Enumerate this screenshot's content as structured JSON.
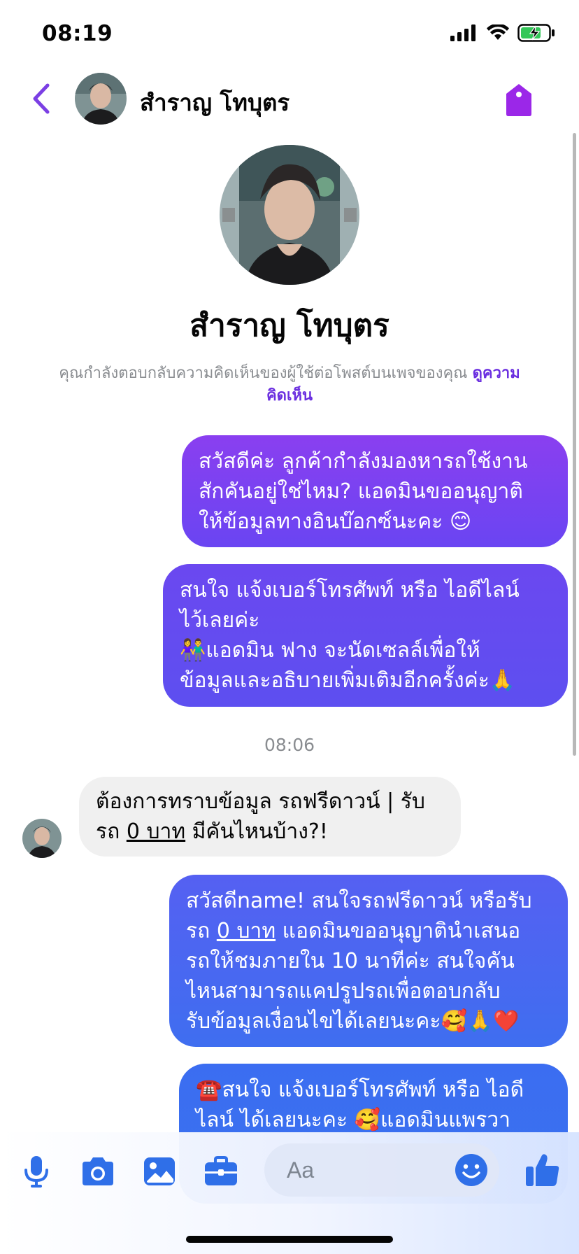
{
  "status_bar": {
    "time": "08:19"
  },
  "header": {
    "contact_name": "สำราญ โทบุตร"
  },
  "profile": {
    "name": "สำราญ โทบุตร"
  },
  "context": {
    "note": "คุณกำลังตอบกลับความคิดเห็นของผู้ใช้ต่อโพสต์บนเพจของคุณ",
    "link_line1": "ดูความ",
    "link_line2": "คิดเห็น"
  },
  "messages": [
    {
      "direction": "outgoing",
      "lines": [
        "สวัสดีค่ะ ลูกค้ากำลังมองหารถใช้งาน",
        "สักคันอยู่ใช่ไหม? แอดมินขออนุญาติ",
        "ให้ข้อมูลทางอินบ๊อกซ์นะคะ 😊"
      ]
    },
    {
      "direction": "outgoing",
      "lines": [
        "สนใจ แจ้งเบอร์โทรศัพท์ หรือ ไอดีไลน์",
        "ไว้เลยค่ะ",
        "👫แอดมิน ฟาง จะนัดเซลล์เพื่อให้",
        "ข้อมูลและอธิบายเพิ่มเติมอีกครั้งค่ะ🙏"
      ]
    },
    {
      "direction": "incoming",
      "line1": "ต้องการทราบข้อมูล รถฟรีดาวน์ | รับ",
      "line2_pre": "รถ ",
      "line2_u": "0 บาท",
      "line2_post": " มีคันไหนบ้าง?!"
    },
    {
      "direction": "outgoing",
      "line1": "สวัสดีname! สนใจรถฟรีดาวน์ หรือรับ",
      "line2_pre": "รถ ",
      "line2_u": "0 บาท",
      "line2_post": " แอดมินขออนุญาตินำเสนอ",
      "line3": "รถให้ชมภายใน 10 นาทีค่ะ สนใจคัน",
      "line4": "ไหนสามารถแคปรูปรถเพื่อตอบกลับ",
      "line5": "รับข้อมูลเงื่อนไขได้เลยนะคะ🥰🙏❤️"
    },
    {
      "direction": "outgoing",
      "lines": [
        "☎️สนใจ แจ้งเบอร์โทรศัพท์ หรือ ไอดี",
        "ไลน์  ได้เลยนะคะ 🥰แอดมินแพรวา"
      ]
    }
  ],
  "time_divider": "08:06",
  "composer": {
    "placeholder": "Aa"
  },
  "colors": {
    "accent": "#7b3fe4",
    "incoming_bubble": "#f0f0f0",
    "icon_blue": "#2f6fe8"
  }
}
